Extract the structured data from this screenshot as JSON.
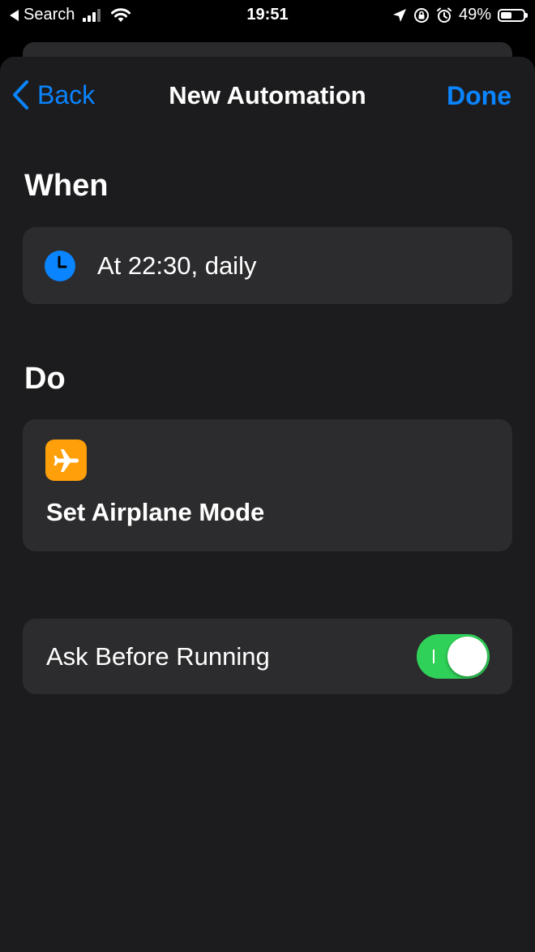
{
  "status_bar": {
    "back_app": "Search",
    "time": "19:51",
    "battery": "49%",
    "battery_level": 0.49
  },
  "nav": {
    "back_label": "Back",
    "title": "New Automation",
    "done_label": "Done"
  },
  "when": {
    "heading": "When",
    "trigger": "At 22:30, daily",
    "icon": "clock-icon"
  },
  "do": {
    "heading": "Do",
    "action": "Set Airplane Mode",
    "icon": "airplane-icon",
    "icon_color": "#ff9f0a"
  },
  "ask_before_running": {
    "label": "Ask Before Running",
    "enabled": true
  },
  "colors": {
    "accent": "#0a84ff",
    "toggle_on": "#30d158",
    "clock": "#0a84ff",
    "sheet_bg": "#1c1c1e",
    "card_bg": "#2c2c2e"
  }
}
